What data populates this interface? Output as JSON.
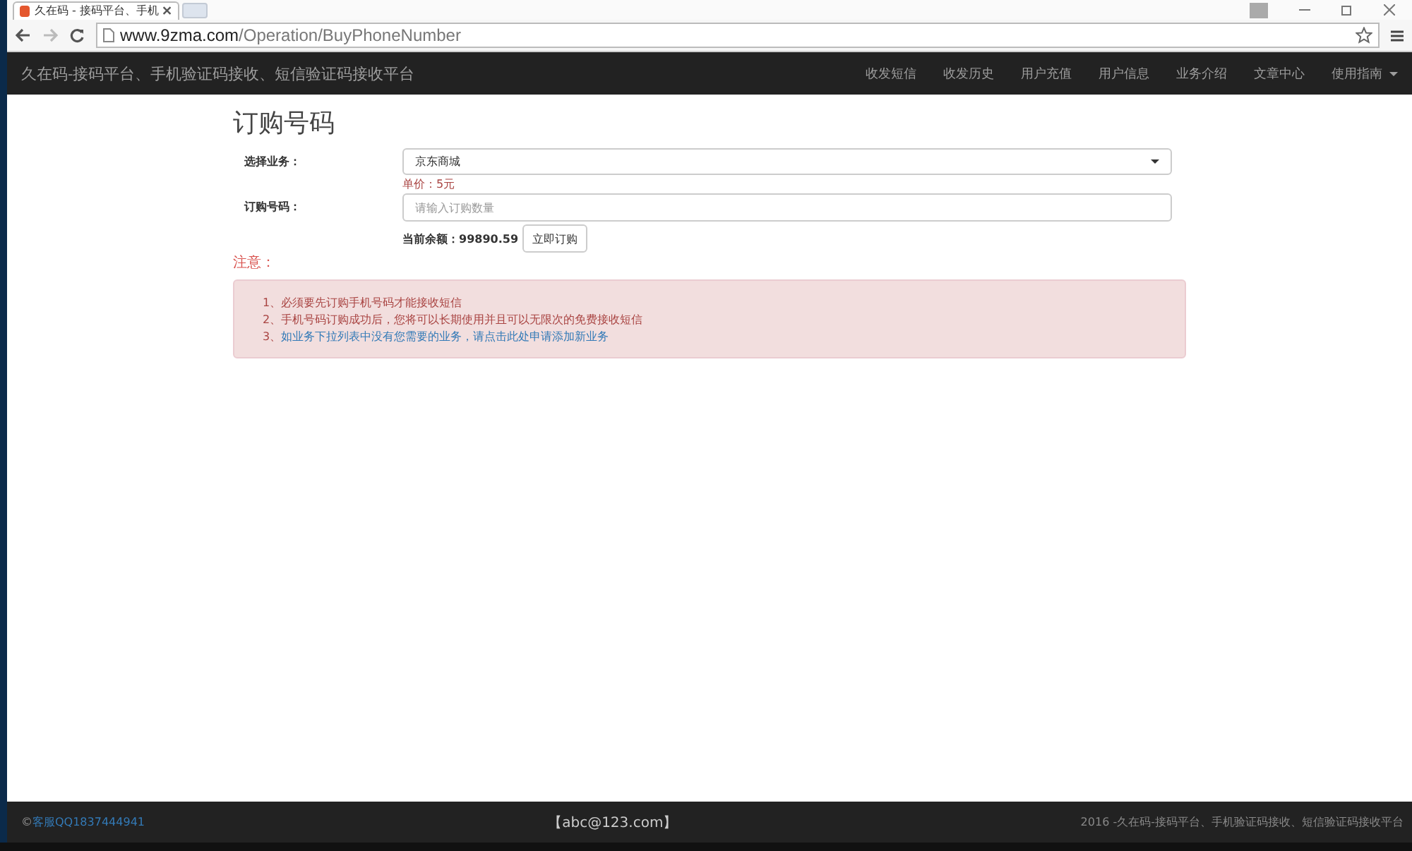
{
  "browser": {
    "tab_title": "久在码 - 接码平台、手机",
    "url_host": "www.9zma.com",
    "url_path": "/Operation/BuyPhoneNumber"
  },
  "navbar": {
    "brand": "久在码-接码平台、手机验证码接收、短信验证码接收平台",
    "items": [
      {
        "label": "收发短信",
        "dropdown": false
      },
      {
        "label": "收发历史",
        "dropdown": false
      },
      {
        "label": "用户充值",
        "dropdown": false
      },
      {
        "label": "用户信息",
        "dropdown": false
      },
      {
        "label": "业务介绍",
        "dropdown": false
      },
      {
        "label": "文章中心",
        "dropdown": false
      },
      {
        "label": "使用指南",
        "dropdown": true
      }
    ]
  },
  "page": {
    "title": "订购号码",
    "service_label": "选择业务：",
    "service_value": "京东商城",
    "price": "单价：5元",
    "number_label": "订购号码：",
    "number_placeholder": "请输入订购数量",
    "balance_label": "当前余额：",
    "balance": "99890.59",
    "order_button": "立即订购",
    "notice_title": "注意：",
    "notices": [
      {
        "text": "1、必须要先订购手机号码才能接收短信"
      },
      {
        "text": "2、手机号码订购成功后，您将可以长期使用并且可以无限次的免费接收短信"
      },
      {
        "text": "3、",
        "link": "如业务下拉列表中没有您需要的业务，请点击此处申请添加新业务"
      }
    ]
  },
  "footer": {
    "copyright": "©",
    "contact": "客服QQ1837444941",
    "email": "【abc@123.com】",
    "tagline": "2016 -久在码-接码平台、手机验证码接收、短信验证码接收平台"
  }
}
